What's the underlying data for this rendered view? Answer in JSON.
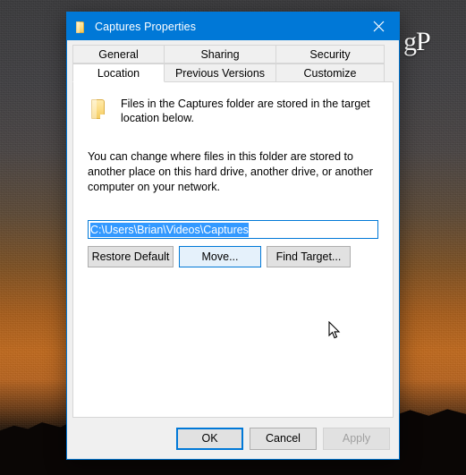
{
  "desktop": {
    "watermark": "gP"
  },
  "dialog": {
    "title": "Captures Properties",
    "title_icon": "folder-icon",
    "close_icon": "close-icon",
    "tabs_row1": [
      {
        "label": "General",
        "selected": false
      },
      {
        "label": "Sharing",
        "selected": false
      },
      {
        "label": "Security",
        "selected": false
      }
    ],
    "tabs_row2": [
      {
        "label": "Location",
        "selected": true
      },
      {
        "label": "Previous Versions",
        "selected": false
      },
      {
        "label": "Customize",
        "selected": false
      }
    ],
    "content": {
      "body_icon": "folder-icon",
      "paragraph1": "Files in the Captures folder are stored in the target location below.",
      "paragraph2": "You can change where files in this folder are stored to another place on this hard drive, another drive, or another computer on your network.",
      "path_value": "C:\\Users\\Brian\\Videos\\Captures",
      "path_selected": true,
      "buttons": [
        {
          "label": "Restore Default",
          "state": "normal"
        },
        {
          "label": "Move...",
          "state": "hover"
        },
        {
          "label": "Find Target...",
          "state": "normal"
        }
      ]
    },
    "footer": {
      "ok_label": "OK",
      "cancel_label": "Cancel",
      "apply_label": "Apply",
      "apply_disabled": true
    },
    "colors": {
      "accent": "#0078d7",
      "titlebar": "#0078d7",
      "selection": "#3399ff",
      "hover_fill": "#e5f1fb",
      "button_face": "#e1e1e1",
      "dialog_face": "#f0f0f0",
      "disabled_text": "#a0a0a0"
    }
  }
}
